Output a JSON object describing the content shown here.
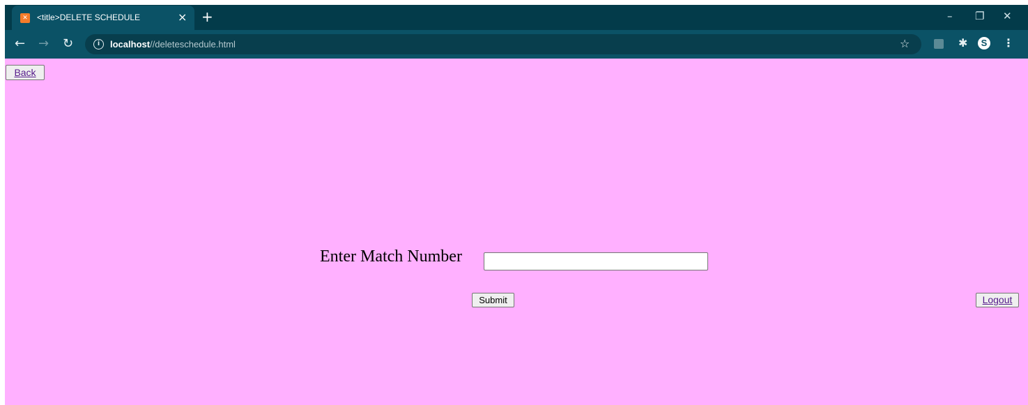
{
  "browser": {
    "tab_title": "<title>DELETE SCHEDULE",
    "tab_close": "×",
    "new_tab": "+",
    "url_host": "localhost",
    "url_path": "//deleteschedule.html",
    "window_controls": {
      "minimize": "–",
      "restore": "❐",
      "close": "✕"
    },
    "icons": [
      "back-arrow-icon",
      "forward-arrow-icon",
      "reload-icon",
      "info-icon",
      "bookmark-star-icon",
      "extension-icon",
      "puzzle-icon",
      "profile-icon",
      "menu-icon"
    ]
  },
  "page": {
    "background_color": "#ffb0ff",
    "back_label": "Back",
    "match_label": "Enter Match Number",
    "match_value": "",
    "submit_label": "Submit",
    "logout_label": "Logout"
  }
}
